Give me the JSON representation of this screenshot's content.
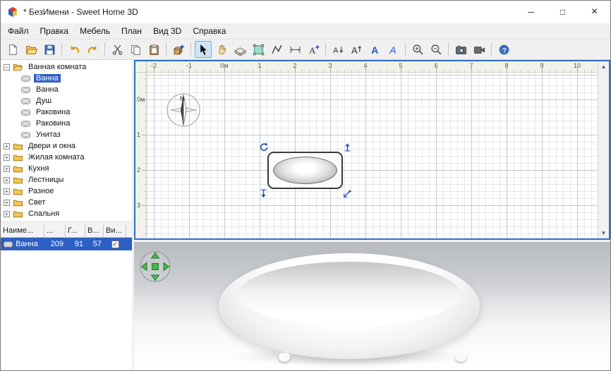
{
  "window": {
    "title": "* БезИмени - Sweet Home 3D",
    "minimize": "─",
    "maximize": "□",
    "close": "×"
  },
  "menu": {
    "items": [
      "Файл",
      "Правка",
      "Мебель",
      "План",
      "Вид 3D",
      "Справка"
    ]
  },
  "toolbar": {
    "pressed": "select",
    "buttons": [
      "new-home",
      "open",
      "save",
      "sep",
      "undo",
      "redo",
      "sep",
      "cut",
      "copy",
      "paste",
      "sep",
      "add-furniture",
      "sep",
      "select",
      "pan",
      "create-walls",
      "create-rooms",
      "create-polylines",
      "create-dimensions",
      "create-texts",
      "sep",
      "decrease-text-size",
      "increase-text-size",
      "bold",
      "italic",
      "sep",
      "zoom-in",
      "zoom-out",
      "sep",
      "create-photo",
      "create-video",
      "sep",
      "help"
    ]
  },
  "catalog": {
    "tree": [
      {
        "label": "Ванная комната",
        "type": "folder",
        "expanded": true,
        "children": [
          {
            "label": "Ванна",
            "selected": true
          },
          {
            "label": "Ванна",
            "selected": false
          },
          {
            "label": "Душ",
            "selected": false
          },
          {
            "label": "Раковина",
            "selected": false
          },
          {
            "label": "Раковина",
            "selected": false
          },
          {
            "label": "Унитаз",
            "selected": false
          }
        ]
      },
      {
        "label": "Двери и окна",
        "type": "folder",
        "expanded": false,
        "children": []
      },
      {
        "label": "Жилая комната",
        "type": "folder",
        "expanded": false,
        "children": []
      },
      {
        "label": "Кухня",
        "type": "folder",
        "expanded": false,
        "children": []
      },
      {
        "label": "Лестницы",
        "type": "folder",
        "expanded": false,
        "children": []
      },
      {
        "label": "Разное",
        "type": "folder",
        "expanded": false,
        "children": []
      },
      {
        "label": "Свет",
        "type": "folder",
        "expanded": false,
        "children": []
      },
      {
        "label": "Спальня",
        "type": "folder",
        "expanded": false,
        "children": []
      }
    ]
  },
  "furniture_list": {
    "columns": [
      "Наиме...",
      "...",
      "Г...",
      "В...",
      "Ви..."
    ],
    "rows": [
      {
        "name": "Ванна",
        "values": [
          "209",
          "91",
          "57"
        ],
        "visible": true,
        "selected": true
      }
    ],
    "checkmark": "✓"
  },
  "plan": {
    "h_ruler": [
      "-2",
      "-1",
      "0м",
      "1",
      "2",
      "3",
      "4",
      "5",
      "6",
      "7",
      "8",
      "9",
      "10"
    ],
    "v_ruler": [
      "0м",
      "1",
      "2",
      "3"
    ],
    "compass_label": "N",
    "scroll_up": "▲",
    "scroll_down": "▼"
  },
  "colors": {
    "selection": "#2e5fc3",
    "plan_focus_border": "#2d6fc9",
    "indicator": "#1749c8",
    "nav_green": "#46b54e"
  }
}
